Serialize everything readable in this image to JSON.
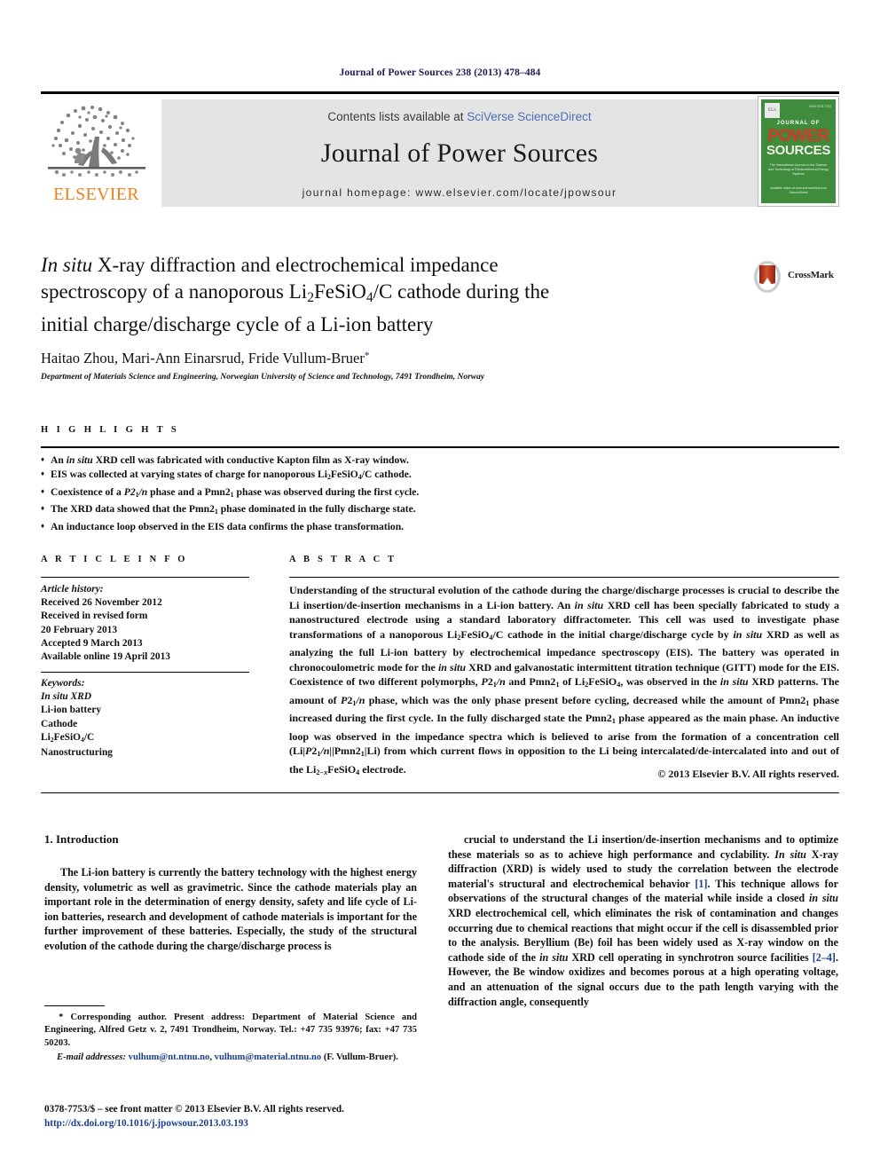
{
  "running_head": "Journal of Power Sources 238 (2013) 478–484",
  "masthead": {
    "contents_prefix": "Contents lists available at ",
    "contents_link": "SciVerse ScienceDirect",
    "journal_name": "Journal of Power Sources",
    "homepage": "journal homepage: www.elsevier.com/locate/jpowsour",
    "publisher_wordmark": "ELSEVIER",
    "publisher_logo_icon": "elsevier-tree-icon",
    "cover": {
      "elsevier_mark": "ELS",
      "issn_line": "ISSN 0378-7753",
      "line_journal_of": "JOURNAL OF",
      "line_power": "POWER",
      "line_sources": "SOURCES",
      "subtitle": "The International Journal on the Science and Technology of Electrochemical Energy Systems",
      "footer": "Available online at www.sciencedirect.com  ScienceDirect",
      "accent_green": "#3e8c3c",
      "accent_red": "#c8442a"
    }
  },
  "article": {
    "title_parts": {
      "italic_lead": "In situ",
      "rest_line1": " X-ray diffraction and electrochemical impedance",
      "line2_a": "spectroscopy of a nanoporous Li",
      "line2_sub1": "2",
      "line2_b": "FeSiO",
      "line2_sub2": "4",
      "line2_c": "/C cathode during the",
      "line3": "initial charge/discharge cycle of a Li-ion battery"
    },
    "title_plain": "In situ X-ray diffraction and electrochemical impedance spectroscopy of a nanoporous Li2FeSiO4/C cathode during the initial charge/discharge cycle of a Li-ion battery",
    "authors": "Haitao Zhou, Mari-Ann Einarsrud, Fride Vullum-Bruer",
    "author_marker": "*",
    "affiliation": "Department of Materials Science and Engineering, Norwegian University of Science and Technology, 7491 Trondheim, Norway",
    "crossmark": {
      "label": "CrossMark",
      "icon": "crossmark-badge-icon"
    }
  },
  "highlights": {
    "heading": "H I G H L I G H T S",
    "items": [
      {
        "pre": "An ",
        "it": "in situ",
        "post": " XRD cell was fabricated with conductive Kapton film as X-ray window."
      },
      {
        "pre": "EIS was collected at varying states of charge for nanoporous Li",
        "sub1": "2",
        "mid": "FeSiO",
        "sub2": "4",
        "post": "/C cathode."
      },
      {
        "pre": "Coexistence of a ",
        "it": "P2",
        "sub1": "1",
        "it2": "/n",
        "mid": " phase and a Pmn2",
        "sub2": "1",
        "post": " phase was observed during the first cycle."
      },
      {
        "pre": "The XRD data showed that the Pmn2",
        "sub1": "1",
        "post": " phase dominated in the fully discharge state."
      },
      {
        "pre": "An inductance loop observed in the EIS data confirms the phase transformation."
      }
    ]
  },
  "article_info": {
    "heading": "A R T I C L E    I N F O",
    "history_label": "Article history:",
    "history": [
      "Received 26 November 2012",
      "Received in revised form",
      "20 February 2013",
      "Accepted 9 March 2013",
      "Available online 19 April 2013"
    ],
    "keywords_label": "Keywords:",
    "keywords": [
      "In situ XRD",
      "Li-ion battery",
      "Cathode",
      "Li2FeSiO4/C",
      "Nanostructuring"
    ]
  },
  "abstract": {
    "heading": "A B S T R A C T",
    "copyright": "© 2013 Elsevier B.V. All rights reserved.",
    "text_plain": "Understanding of the structural evolution of the cathode during the charge/discharge processes is crucial to describe the Li insertion/de-insertion mechanisms in a Li-ion battery. An in situ XRD cell has been specially fabricated to study a nanostructured electrode using a standard laboratory diffractometer. This cell was used to investigate phase transformations of a nanoporous Li2FeSiO4/C cathode in the initial charge/discharge cycle by in situ XRD as well as analyzing the full Li-ion battery by electrochemical impedance spectroscopy (EIS). The battery was operated in chronocoulometric mode for the in situ XRD and galvanostatic intermittent titration technique (GITT) mode for the EIS. Coexistence of two different polymorphs, P21/n and Pmn21 of Li2FeSiO4, was observed in the in situ XRD patterns. The amount of P21/n phase, which was the only phase present before cycling, decreased while the amount of Pmn21 phase increased during the first cycle. In the fully discharged state the Pmn21 phase appeared as the main phase. An inductive loop was observed in the impedance spectra which is believed to arise from the formation of a concentration cell (Li|P21/n||Pmn21|Li) from which current flows in opposition to the Li being intercalated/de-intercalated into and out of the Li2−xFeSiO4 electrode."
  },
  "body": {
    "section_number_title": "1. Introduction",
    "left_column_plain": "The Li-ion battery is currently the battery technology with the highest energy density, volumetric as well as gravimetric. Since the cathode materials play an important role in the determination of energy density, safety and life cycle of Li-ion batteries, research and development of cathode materials is important for the further improvement of these batteries. Especially, the study of the structural evolution of the cathode during the charge/discharge process is",
    "right_column_plain": "crucial to understand the Li insertion/de-insertion mechanisms and to optimize these materials so as to achieve high performance and cyclability. In situ X-ray diffraction (XRD) is widely used to study the correlation between the electrode material's structural and electrochemical behavior [1]. This technique allows for observations of the structural changes of the material while inside a closed in situ XRD electrochemical cell, which eliminates the risk of contamination and changes occurring due to chemical reactions that might occur if the cell is disassembled prior to the analysis. Beryllium (Be) foil has been widely used as X-ray window on the cathode side of the in situ XRD cell operating in synchrotron source facilities [2–4]. However, the Be window oxidizes and becomes porous at a high operating voltage, and an attenuation of the signal occurs due to the path length varying with the diffraction angle, consequently",
    "reference_marks": [
      "[1]",
      "[2–4]"
    ]
  },
  "footnote": {
    "marker": "*",
    "corresponding": "Corresponding author. Present address: Department of Material Science and Engineering, Alfred Getz v. 2, 7491 Trondheim, Norway. Tel.: +47 735 93976; fax: +47 735 50203.",
    "email_label": "E-mail addresses:",
    "email_1": "vulhum@nt.ntnu.no",
    "email_2": "vulhum@material.ntnu.no",
    "email_owner": "(F. Vullum-Bruer)."
  },
  "imprint": {
    "issn_line": "0378-7753/$ – see front matter © 2013 Elsevier B.V. All rights reserved.",
    "doi": "http://dx.doi.org/10.1016/j.jpowsour.2013.03.193"
  }
}
